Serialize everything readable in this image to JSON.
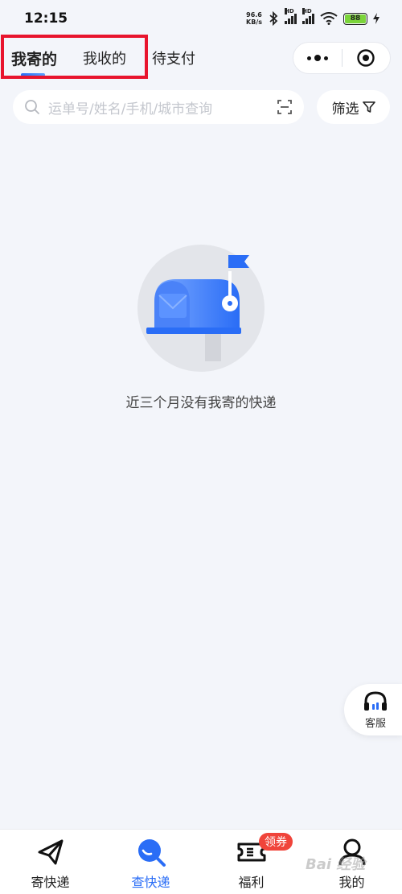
{
  "status_bar": {
    "time": "12:15",
    "net_speed_value": "96.6",
    "net_speed_unit": "KB/s",
    "signal1_label": "HD",
    "signal2_label": "HD",
    "battery": "88"
  },
  "tabs": [
    {
      "label": "我寄的",
      "active": true
    },
    {
      "label": "我收的",
      "active": false
    },
    {
      "label": "待支付",
      "active": false
    }
  ],
  "search": {
    "placeholder": "运单号/姓名/手机/城市查询"
  },
  "filter": {
    "label": "筛选"
  },
  "empty_state": {
    "message": "近三个月没有我寄的快递"
  },
  "customer_service": {
    "label": "客服"
  },
  "bottom_nav": [
    {
      "label": "寄快递",
      "icon": "paper-plane-icon",
      "active": false
    },
    {
      "label": "查快递",
      "icon": "search-icon",
      "active": true
    },
    {
      "label": "福利",
      "icon": "ticket-icon",
      "active": false,
      "badge": "领券"
    },
    {
      "label": "我的",
      "icon": "user-icon",
      "active": false
    }
  ],
  "colors": {
    "accent": "#2a6df6",
    "highlight_box": "#e8142d",
    "badge": "#f0443a",
    "background": "#f3f5fa"
  },
  "watermark": "Bai 经验"
}
